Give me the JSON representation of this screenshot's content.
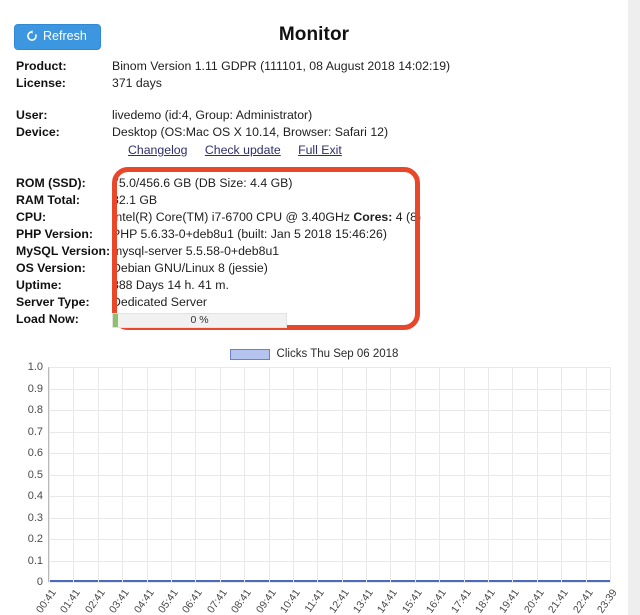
{
  "toolbar": {
    "refresh_label": "Refresh",
    "refresh_icon": "refresh-icon",
    "refresh_glyph": "↺",
    "accent_color": "#3d96e0"
  },
  "header": {
    "title": "Monitor"
  },
  "info": {
    "rows": [
      {
        "label": "Product:",
        "value": "Binom Version 1.11 GDPR (111101, 08 August 2018 14:02:19)"
      },
      {
        "label": "License:",
        "value": "371 days"
      },
      {
        "label": "User:",
        "value": "livedemo (id:4, Group: Administrator)"
      },
      {
        "label": "Device:",
        "value": "Desktop (OS:Mac OS X 10.14, Browser: Safari 12)"
      }
    ],
    "links": [
      {
        "label": "Changelog"
      },
      {
        "label": "Check update"
      },
      {
        "label": "Full Exit"
      }
    ]
  },
  "system": {
    "highlight_color": "#e8472a",
    "rows": [
      {
        "label": "ROM (SSD):",
        "value": "75.0/456.6 GB (DB Size: 4.4 GB)"
      },
      {
        "label": "RAM Total:",
        "value": "32.1 GB"
      },
      {
        "label": "CPU:",
        "value": "Intel(R) Core(TM) i7-6700 CPU @ 3.40GHz ",
        "value_bold": "Cores:",
        "value_tail": " 4 (8)"
      },
      {
        "label": "PHP Version:",
        "value": "PHP 5.6.33-0+deb8u1 (built: Jan 5 2018 15:46:26)"
      },
      {
        "label": "MySQL Version:",
        "value": "mysql-server 5.5.58-0+deb8u1"
      },
      {
        "label": "OS Version:",
        "value": "Debian GNU/Linux 8 (jessie)"
      },
      {
        "label": "Uptime:",
        "value": "388 Days 14 h. 41 m."
      },
      {
        "label": "Server Type:",
        "value": "Dedicated Server"
      }
    ],
    "load": {
      "label": "Load Now:",
      "percent_text": "0 %",
      "percent": 0,
      "fill_color": "#8dc26b"
    }
  },
  "chart_data": {
    "type": "line",
    "title": "",
    "xlabel": "",
    "ylabel": "",
    "ylim": [
      0,
      1.0
    ],
    "grid": true,
    "legend_position": "top-center",
    "legend": [
      "Clicks Thu Sep 06 2018"
    ],
    "series": [
      {
        "name": "Clicks Thu Sep 06 2018",
        "color": "#4a6bbd",
        "fill_color": "#b5c4ef",
        "values": [
          0,
          0,
          0,
          0,
          0,
          0,
          0,
          0,
          0,
          0,
          0,
          0,
          0,
          0,
          0,
          0,
          0,
          0,
          0,
          0,
          0,
          0,
          0,
          0
        ]
      }
    ],
    "categories": [
      "00:41",
      "01:41",
      "02:41",
      "03:41",
      "04:41",
      "05:41",
      "06:41",
      "07:41",
      "08:41",
      "09:41",
      "10:41",
      "11:41",
      "12:41",
      "13:41",
      "14:41",
      "15:41",
      "16:41",
      "17:41",
      "18:41",
      "19:41",
      "20:41",
      "21:41",
      "22:41",
      "23:39"
    ],
    "ytick_labels": [
      "1.0",
      "0.9",
      "0.8",
      "0.7",
      "0.6",
      "0.5",
      "0.4",
      "0.3",
      "0.2",
      "0.1",
      "0"
    ],
    "ytick_values": [
      1.0,
      0.9,
      0.8,
      0.7,
      0.6,
      0.5,
      0.4,
      0.3,
      0.2,
      0.1,
      0
    ]
  }
}
